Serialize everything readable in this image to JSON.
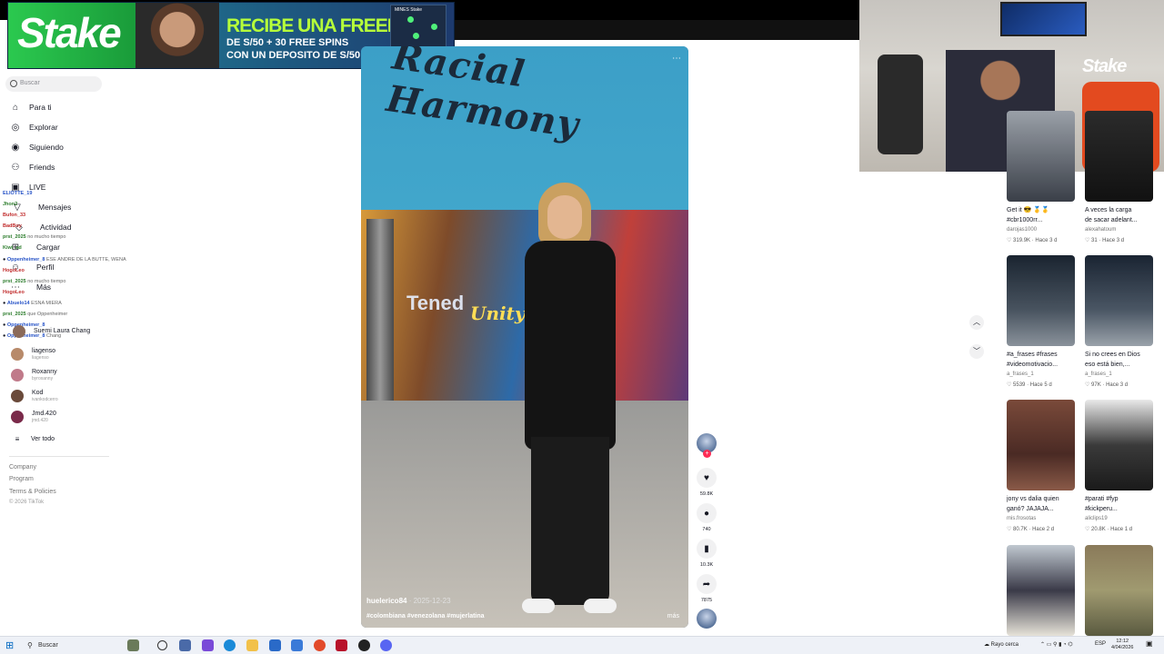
{
  "banner": {
    "brand": "Stake",
    "headline": "RECIBE UNA FREEBET",
    "line2": "DE S/50 + 30 FREE SPINS",
    "line3": "CON UN DEPOSITO DE S/50",
    "card_title": "MINES Stake"
  },
  "sidebar": {
    "search_placeholder": "Buscar",
    "nav": [
      {
        "label": "Para ti",
        "icon": "home-icon"
      },
      {
        "label": "Explorar",
        "icon": "compass-icon"
      },
      {
        "label": "Siguiendo",
        "icon": "following-icon"
      },
      {
        "label": "Friends",
        "icon": "friends-icon"
      },
      {
        "label": "LIVE",
        "icon": "live-icon"
      },
      {
        "label": "Mensajes",
        "icon": "messages-icon"
      },
      {
        "label": "Actividad",
        "icon": "activity-icon"
      },
      {
        "label": "Cargar",
        "icon": "upload-icon"
      },
      {
        "label": "Perfil",
        "icon": "profile-icon"
      },
      {
        "label": "Más",
        "icon": "more-icon"
      }
    ],
    "following": [
      {
        "name": "Suemi Laura Chang",
        "handle": ""
      },
      {
        "name": "liagenso",
        "handle": "liagenso"
      },
      {
        "name": "Roxanny",
        "handle": "byroxanny"
      },
      {
        "name": "Kod",
        "handle": "ivankodcerro"
      },
      {
        "name": "Jmd.420",
        "handle": "jmd.420"
      }
    ],
    "see_all": "Ver todo",
    "footer": [
      "Company",
      "Program",
      "Terms & Policies"
    ],
    "copyright": "© 2026 TikTok"
  },
  "chat_overlay": [
    {
      "user": "ELIOTTE_19",
      "msg": ""
    },
    {
      "user": "Jhon2",
      "msg": ""
    },
    {
      "user": "Bufon_33",
      "msg": ""
    },
    {
      "user": "BadBoy",
      "msg": ""
    },
    {
      "user": "prst_2025",
      "msg": "no mucho tiempo"
    },
    {
      "user": "Kiwi_ad",
      "msg": ""
    },
    {
      "user": "Oppenheimer_8",
      "msg": "ESE ANDRE DE LA BUTTE, WENA"
    },
    {
      "user": "HogoLeo",
      "msg": ""
    },
    {
      "user": "prst_2025",
      "msg": "no mucho tiempo"
    },
    {
      "user": "HogoLeo",
      "msg": ""
    },
    {
      "user": "Abuelo14",
      "msg": "ESNA MIERA"
    },
    {
      "user": "prst_2025",
      "msg": "que Oppenheimer"
    },
    {
      "user": "Oppenheimer_8",
      "msg": ""
    },
    {
      "user": "Oppenheimer_8",
      "msg": "Chang"
    }
  ],
  "video": {
    "mural_title": "Racial Harmony",
    "mural_word1": "Tened",
    "mural_word2": "Unity",
    "username": "huelerico84",
    "date": "· 2025-12-23",
    "tags": "#colombiana #venezolana #mujerlatina",
    "more": "más"
  },
  "actions": {
    "likes": "59.8K",
    "comments": "740",
    "saves": "10.3K",
    "shares": "7875"
  },
  "thumbs": [
    {
      "caption": "Get it 😎 🥇🥇",
      "caption2": "#cbr1000rr...",
      "author": "darojas1000",
      "views": "319.9K",
      "time": "Hace 3 d",
      "bg": "linear-gradient(180deg,#9aa0a8,#3a3f48)"
    },
    {
      "caption": "A veces la carga",
      "caption2": "de sacar adelant...",
      "author": "alexahatoum",
      "views": "31",
      "time": "Hace 3 d",
      "bg": "linear-gradient(180deg,#2b2b2b,#111)"
    },
    {
      "caption": "#a_frases #frases",
      "caption2": "#videomotivacio...",
      "author": "a_frases_1",
      "views": "5539",
      "time": "Hace 5 d",
      "bg": "linear-gradient(180deg,#1a2430,#48535f 60%,#8a929b)"
    },
    {
      "caption": "Si no crees en Dios",
      "caption2": "eso está bien,...",
      "author": "a_frases_1",
      "views": "97K",
      "time": "Hace 3 d",
      "bg": "linear-gradient(180deg,#1a2432,#4a5664 60%,#9aa2aa)"
    },
    {
      "caption": "jony vs dalia quien",
      "caption2": "ganó? JAJAJA...",
      "author": "mis.frosotas",
      "views": "80.7K",
      "time": "Hace 2 d",
      "bg": "linear-gradient(180deg,#7a4a3a,#4a2a24 60%,#8a5a48)"
    },
    {
      "caption": "#parati #fyp",
      "caption2": "#kickperu...",
      "author": "aliclips19",
      "views": "20.8K",
      "time": "Hace 1 d",
      "bg": "linear-gradient(180deg,#e9e9e9,#3a3a3a 50%,#1a1a1a)"
    },
    {
      "caption": "",
      "caption2": "",
      "author": "",
      "views": "",
      "time": "",
      "bg": "linear-gradient(180deg,#c0c8d0,#3a3a48 50%,#e6e2d8)"
    },
    {
      "caption": "",
      "caption2": "",
      "author": "",
      "views": "",
      "time": "",
      "bg": "linear-gradient(180deg,#8a7a5a,#a09a70 50%,#5a5a40)"
    }
  ],
  "taskbar": {
    "search": "Buscar",
    "weather": "Rayo cerca",
    "lang": "ESP",
    "time": "12:12",
    "date": "4/04/2026"
  },
  "colors": {
    "like": "#fe2c55",
    "stake_green": "#2bc94f"
  }
}
